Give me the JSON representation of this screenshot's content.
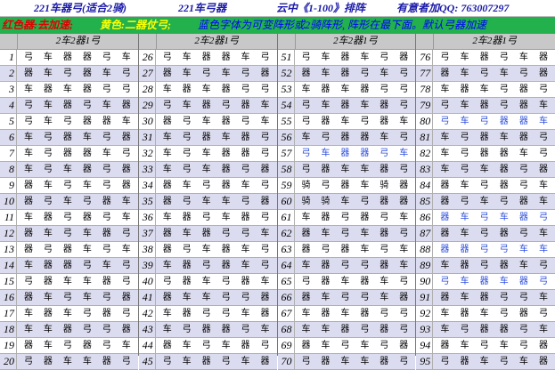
{
  "title": {
    "part1": "221车器弓(适合2骑)",
    "part2": "221车弓器",
    "part3": "云中《1-100》排阵",
    "part4": "有意者加QQ: 763007297"
  },
  "notes": {
    "red": "红色器:去加速;",
    "yellow": "黄色:二器仗弓;",
    "blue": "蓝色字体为可变阵形或2骑阵形, 阵形在最下面。默认弓器加速"
  },
  "header_label": "2车2器1弓",
  "colors": {
    "title_text": "#1a1aa8",
    "note_bar": "#22b14c",
    "note_red": "#e00000",
    "note_yellow": "#ffff00",
    "note_blue": "#0000ff",
    "blue_formation": "#2a4bdc"
  },
  "blocks": [
    {
      "rows": [
        {
          "n": "1",
          "cells": [
            "弓",
            "车",
            "器",
            "器",
            "弓",
            "车"
          ],
          "blue": false
        },
        {
          "n": "2",
          "cells": [
            "器",
            "车",
            "弓",
            "器",
            "车",
            "弓"
          ],
          "blue": false
        },
        {
          "n": "3",
          "cells": [
            "车",
            "器",
            "车",
            "器",
            "弓",
            "弓"
          ],
          "blue": false
        },
        {
          "n": "4",
          "cells": [
            "弓",
            "车",
            "器",
            "弓",
            "车",
            "器"
          ],
          "blue": false
        },
        {
          "n": "5",
          "cells": [
            "弓",
            "车",
            "弓",
            "器",
            "器",
            "车"
          ],
          "blue": false
        },
        {
          "n": "6",
          "cells": [
            "车",
            "弓",
            "器",
            "车",
            "弓",
            "器"
          ],
          "blue": false
        },
        {
          "n": "7",
          "cells": [
            "车",
            "弓",
            "器",
            "器",
            "车",
            "弓"
          ],
          "blue": false
        },
        {
          "n": "8",
          "cells": [
            "车",
            "弓",
            "车",
            "器",
            "弓",
            "器"
          ],
          "blue": false
        },
        {
          "n": "9",
          "cells": [
            "器",
            "车",
            "弓",
            "车",
            "弓",
            "器"
          ],
          "blue": false
        },
        {
          "n": "10",
          "cells": [
            "器",
            "弓",
            "车",
            "弓",
            "器",
            "车"
          ],
          "blue": false
        },
        {
          "n": "11",
          "cells": [
            "车",
            "器",
            "弓",
            "器",
            "弓",
            "车"
          ],
          "blue": false
        },
        {
          "n": "12",
          "cells": [
            "器",
            "车",
            "弓",
            "车",
            "器",
            "弓"
          ],
          "blue": false
        },
        {
          "n": "13",
          "cells": [
            "器",
            "弓",
            "器",
            "车",
            "弓",
            "车"
          ],
          "blue": false
        },
        {
          "n": "14",
          "cells": [
            "车",
            "器",
            "器",
            "弓",
            "车",
            "弓"
          ],
          "blue": false
        },
        {
          "n": "15",
          "cells": [
            "弓",
            "器",
            "车",
            "车",
            "器",
            "弓"
          ],
          "blue": false
        },
        {
          "n": "16",
          "cells": [
            "器",
            "车",
            "弓",
            "车",
            "弓",
            "器"
          ],
          "blue": false
        },
        {
          "n": "17",
          "cells": [
            "车",
            "器",
            "车",
            "弓",
            "器",
            "弓"
          ],
          "blue": false
        },
        {
          "n": "18",
          "cells": [
            "车",
            "车",
            "器",
            "弓",
            "弓",
            "器"
          ],
          "blue": false
        },
        {
          "n": "19",
          "cells": [
            "器",
            "车",
            "弓",
            "器",
            "弓",
            "车"
          ],
          "blue": false
        },
        {
          "n": "20",
          "cells": [
            "弓",
            "器",
            "车",
            "车",
            "器",
            "弓"
          ],
          "blue": false
        }
      ]
    },
    {
      "rows": [
        {
          "n": "26",
          "cells": [
            "弓",
            "车",
            "器",
            "器",
            "车",
            "弓"
          ],
          "blue": false
        },
        {
          "n": "27",
          "cells": [
            "器",
            "车",
            "弓",
            "车",
            "弓",
            "器"
          ],
          "blue": false
        },
        {
          "n": "28",
          "cells": [
            "车",
            "器",
            "车",
            "器",
            "弓",
            "弓"
          ],
          "blue": false
        },
        {
          "n": "29",
          "cells": [
            "弓",
            "车",
            "器",
            "弓",
            "器",
            "车"
          ],
          "blue": false
        },
        {
          "n": "30",
          "cells": [
            "器",
            "弓",
            "车",
            "器",
            "弓",
            "车"
          ],
          "blue": false
        },
        {
          "n": "31",
          "cells": [
            "车",
            "弓",
            "器",
            "车",
            "器",
            "弓"
          ],
          "blue": false
        },
        {
          "n": "32",
          "cells": [
            "车",
            "弓",
            "车",
            "器",
            "器",
            "弓"
          ],
          "blue": false
        },
        {
          "n": "33",
          "cells": [
            "车",
            "弓",
            "车",
            "器",
            "弓",
            "器"
          ],
          "blue": false
        },
        {
          "n": "34",
          "cells": [
            "器",
            "车",
            "弓",
            "器",
            "车",
            "弓"
          ],
          "blue": false
        },
        {
          "n": "35",
          "cells": [
            "器",
            "弓",
            "车",
            "车",
            "弓",
            "器"
          ],
          "blue": false
        },
        {
          "n": "36",
          "cells": [
            "车",
            "器",
            "弓",
            "车",
            "器",
            "弓"
          ],
          "blue": false
        },
        {
          "n": "37",
          "cells": [
            "器",
            "车",
            "器",
            "弓",
            "弓",
            "车"
          ],
          "blue": false
        },
        {
          "n": "38",
          "cells": [
            "器",
            "弓",
            "车",
            "器",
            "车",
            "弓"
          ],
          "blue": false
        },
        {
          "n": "39",
          "cells": [
            "车",
            "器",
            "弓",
            "器",
            "车",
            "弓"
          ],
          "blue": false
        },
        {
          "n": "40",
          "cells": [
            "弓",
            "器",
            "车",
            "弓",
            "器",
            "车"
          ],
          "blue": false
        },
        {
          "n": "41",
          "cells": [
            "器",
            "车",
            "车",
            "弓",
            "弓",
            "器"
          ],
          "blue": false
        },
        {
          "n": "42",
          "cells": [
            "车",
            "器",
            "弓",
            "弓",
            "车",
            "器"
          ],
          "blue": false
        },
        {
          "n": "43",
          "cells": [
            "车",
            "弓",
            "器",
            "器",
            "弓",
            "车"
          ],
          "blue": false
        },
        {
          "n": "44",
          "cells": [
            "器",
            "车",
            "弓",
            "车",
            "器",
            "弓"
          ],
          "blue": false
        },
        {
          "n": "45",
          "cells": [
            "弓",
            "车",
            "器",
            "弓",
            "车",
            "器"
          ],
          "blue": false
        }
      ]
    },
    {
      "rows": [
        {
          "n": "51",
          "cells": [
            "弓",
            "车",
            "器",
            "车",
            "弓",
            "器"
          ],
          "blue": false
        },
        {
          "n": "52",
          "cells": [
            "器",
            "车",
            "器",
            "弓",
            "车",
            "弓"
          ],
          "blue": false
        },
        {
          "n": "53",
          "cells": [
            "车",
            "器",
            "车",
            "器",
            "弓",
            "弓"
          ],
          "blue": false
        },
        {
          "n": "54",
          "cells": [
            "弓",
            "车",
            "器",
            "车",
            "器",
            "弓"
          ],
          "blue": false
        },
        {
          "n": "55",
          "cells": [
            "弓",
            "器",
            "车",
            "弓",
            "器",
            "车"
          ],
          "blue": false
        },
        {
          "n": "56",
          "cells": [
            "车",
            "弓",
            "器",
            "器",
            "车",
            "弓"
          ],
          "blue": false
        },
        {
          "n": "57",
          "cells": [
            "弓",
            "车",
            "器",
            "器",
            "弓",
            "车"
          ],
          "blue": true
        },
        {
          "n": "58",
          "cells": [
            "弓",
            "器",
            "车",
            "车",
            "器",
            "弓"
          ],
          "blue": false
        },
        {
          "n": "59",
          "cells": [
            "骑",
            "弓",
            "器",
            "车",
            "骑",
            "器"
          ],
          "blue": false
        },
        {
          "n": "60",
          "cells": [
            "骑",
            "骑",
            "车",
            "弓",
            "器",
            "器"
          ],
          "blue": false
        },
        {
          "n": "61",
          "cells": [
            "车",
            "器",
            "弓",
            "器",
            "弓",
            "车"
          ],
          "blue": false
        },
        {
          "n": "62",
          "cells": [
            "器",
            "车",
            "弓",
            "车",
            "器",
            "弓"
          ],
          "blue": false
        },
        {
          "n": "63",
          "cells": [
            "器",
            "弓",
            "器",
            "车",
            "弓",
            "车"
          ],
          "blue": false
        },
        {
          "n": "64",
          "cells": [
            "车",
            "器",
            "弓",
            "弓",
            "器",
            "车"
          ],
          "blue": false
        },
        {
          "n": "65",
          "cells": [
            "弓",
            "器",
            "车",
            "器",
            "车",
            "弓"
          ],
          "blue": false
        },
        {
          "n": "66",
          "cells": [
            "器",
            "车",
            "弓",
            "弓",
            "车",
            "器"
          ],
          "blue": false
        },
        {
          "n": "67",
          "cells": [
            "车",
            "器",
            "车",
            "器",
            "弓",
            "弓"
          ],
          "blue": false
        },
        {
          "n": "68",
          "cells": [
            "车",
            "车",
            "器",
            "弓",
            "器",
            "弓"
          ],
          "blue": false
        },
        {
          "n": "69",
          "cells": [
            "器",
            "车",
            "弓",
            "车",
            "弓",
            "器"
          ],
          "blue": false
        },
        {
          "n": "70",
          "cells": [
            "弓",
            "器",
            "车",
            "车",
            "器",
            "弓"
          ],
          "blue": false
        }
      ]
    },
    {
      "rows": [
        {
          "n": "76",
          "cells": [
            "弓",
            "车",
            "器",
            "弓",
            "车",
            "器"
          ],
          "blue": false
        },
        {
          "n": "77",
          "cells": [
            "器",
            "车",
            "弓",
            "车",
            "弓",
            "器"
          ],
          "blue": false
        },
        {
          "n": "78",
          "cells": [
            "车",
            "器",
            "车",
            "弓",
            "器",
            "弓"
          ],
          "blue": false
        },
        {
          "n": "79",
          "cells": [
            "弓",
            "车",
            "器",
            "弓",
            "器",
            "车"
          ],
          "blue": false
        },
        {
          "n": "80",
          "cells": [
            "弓",
            "车",
            "弓",
            "器",
            "器",
            "车"
          ],
          "blue": true
        },
        {
          "n": "81",
          "cells": [
            "车",
            "弓",
            "器",
            "车",
            "器",
            "弓"
          ],
          "blue": false
        },
        {
          "n": "82",
          "cells": [
            "车",
            "弓",
            "器",
            "器",
            "车",
            "弓"
          ],
          "blue": false
        },
        {
          "n": "83",
          "cells": [
            "车",
            "弓",
            "车",
            "器",
            "弓",
            "器"
          ],
          "blue": false
        },
        {
          "n": "84",
          "cells": [
            "器",
            "车",
            "弓",
            "器",
            "弓",
            "车"
          ],
          "blue": false
        },
        {
          "n": "85",
          "cells": [
            "器",
            "弓",
            "车",
            "弓",
            "器",
            "车"
          ],
          "blue": false
        },
        {
          "n": "86",
          "cells": [
            "器",
            "车",
            "弓",
            "车",
            "器",
            "弓"
          ],
          "blue": true
        },
        {
          "n": "87",
          "cells": [
            "器",
            "车",
            "弓",
            "器",
            "弓",
            "车"
          ],
          "blue": false
        },
        {
          "n": "88",
          "cells": [
            "器",
            "器",
            "弓",
            "弓",
            "车",
            "车"
          ],
          "blue": true
        },
        {
          "n": "89",
          "cells": [
            "车",
            "器",
            "弓",
            "器",
            "车",
            "弓"
          ],
          "blue": false
        },
        {
          "n": "90",
          "cells": [
            "弓",
            "车",
            "器",
            "车",
            "器",
            "弓"
          ],
          "blue": true
        },
        {
          "n": "91",
          "cells": [
            "器",
            "车",
            "器",
            "弓",
            "弓",
            "车"
          ],
          "blue": false
        },
        {
          "n": "92",
          "cells": [
            "车",
            "器",
            "车",
            "弓",
            "器",
            "弓"
          ],
          "blue": false
        },
        {
          "n": "93",
          "cells": [
            "车",
            "弓",
            "器",
            "器",
            "弓",
            "车"
          ],
          "blue": false
        },
        {
          "n": "94",
          "cells": [
            "器",
            "车",
            "弓",
            "车",
            "弓",
            "器"
          ],
          "blue": false
        },
        {
          "n": "95",
          "cells": [
            "弓",
            "器",
            "车",
            "弓",
            "车",
            "器"
          ],
          "blue": false
        }
      ]
    }
  ]
}
